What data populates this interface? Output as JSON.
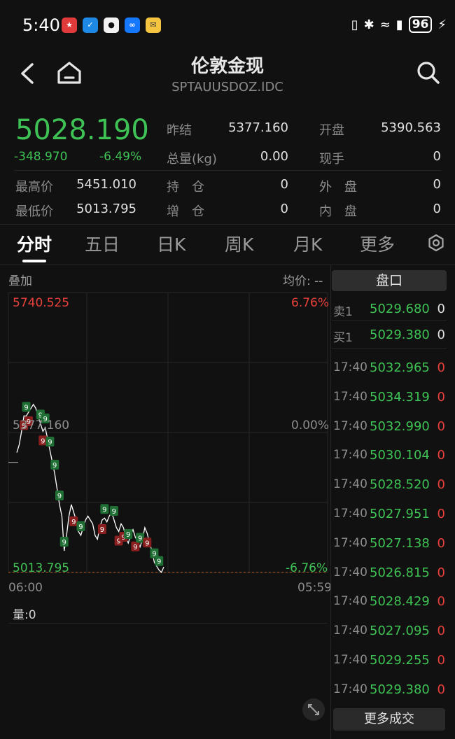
{
  "status_bar": {
    "time": "5:40",
    "battery": "96",
    "icons": [
      "nfc-icon",
      "bluetooth-icon",
      "wifi-icon",
      "signal-icon",
      "charging-icon"
    ]
  },
  "header": {
    "title": "伦敦金现",
    "subtitle": "SPTAUUSDOZ.IDC"
  },
  "quote": {
    "price": "5028.190",
    "change": "-348.970",
    "change_pct": "-6.49%",
    "fields": [
      {
        "label": "昨结",
        "value": "5377.160"
      },
      {
        "label": "开盘",
        "value": "5390.563"
      },
      {
        "label": "总量(kg)",
        "value": "0.00"
      },
      {
        "label": "现手",
        "value": "0"
      },
      {
        "label": "最高价",
        "value": "5451.010"
      },
      {
        "label": "持　仓",
        "value": "0"
      },
      {
        "label": "外　盘",
        "value": "0"
      },
      {
        "label": "最低价",
        "value": "5013.795"
      },
      {
        "label": "增　仓",
        "value": "0"
      },
      {
        "label": "内　盘",
        "value": "0"
      }
    ]
  },
  "tabs": [
    {
      "label": "分时"
    },
    {
      "label": "五日"
    },
    {
      "label": "日K"
    },
    {
      "label": "周K"
    },
    {
      "label": "月K"
    },
    {
      "label": "更多"
    }
  ],
  "chart": {
    "overlay_label": "叠加",
    "avg_label": "均价: --",
    "top_price": "5740.525",
    "top_pct": "6.76%",
    "mid_price": "5377.160",
    "mid_pct": "0.00%",
    "bottom_price": "5013.795",
    "bottom_pct": "-6.76%",
    "time_start": "06:00",
    "time_end": "05:59",
    "volume_label": "量:0",
    "marker_text": "9",
    "colors": {
      "up": "#e8413b",
      "down": "#3fc255",
      "line": "#ffffff",
      "grid": "#262626"
    }
  },
  "chart_data": {
    "type": "line",
    "title": "",
    "xlabel": "",
    "ylabel": "",
    "ylim": [
      5013.795,
      5740.525
    ],
    "x_labels": [
      "06:00",
      "05:59"
    ],
    "series": [
      {
        "values": [
          5325,
          5345,
          5380,
          5420,
          5420,
          5430,
          5440,
          5450,
          5440,
          5420,
          5400,
          5380,
          5390,
          5360,
          5330,
          5300,
          5270,
          5230,
          5190,
          5160,
          5070,
          5110,
          5160,
          5190,
          5170,
          5150,
          5120,
          5110,
          5130,
          5150,
          5160,
          5150,
          5140,
          5110,
          5100,
          5130,
          5150,
          5155,
          5145,
          5160,
          5170,
          5150,
          5130,
          5120,
          5140,
          5130,
          5105,
          5090,
          5110,
          5125,
          5105,
          5095,
          5080,
          5100,
          5130,
          5115,
          5090,
          5070,
          5040,
          5030,
          5020,
          5014,
          5028
        ]
      }
    ],
    "markers": [
      {
        "index": 3,
        "type": "down"
      },
      {
        "index": 5,
        "type": "down"
      },
      {
        "index": 4,
        "type": "up"
      },
      {
        "index": 10,
        "type": "up"
      },
      {
        "index": 11,
        "type": "down"
      },
      {
        "index": 12,
        "type": "up"
      },
      {
        "index": 14,
        "type": "up"
      },
      {
        "index": 16,
        "type": "up"
      },
      {
        "index": 18,
        "type": "up"
      },
      {
        "index": 20,
        "type": "up"
      },
      {
        "index": 24,
        "type": "down"
      },
      {
        "index": 27,
        "type": "up"
      },
      {
        "index": 36,
        "type": "down"
      },
      {
        "index": 37,
        "type": "up"
      },
      {
        "index": 41,
        "type": "up"
      },
      {
        "index": 43,
        "type": "down"
      },
      {
        "index": 45,
        "type": "down"
      },
      {
        "index": 47,
        "type": "up"
      },
      {
        "index": 50,
        "type": "down"
      },
      {
        "index": 52,
        "type": "up"
      },
      {
        "index": 55,
        "type": "down"
      },
      {
        "index": 58,
        "type": "up"
      },
      {
        "index": 60,
        "type": "up"
      }
    ]
  },
  "order_book": {
    "title": "盘口",
    "asks": [
      {
        "label": "卖1",
        "price": "5029.680",
        "volume": "0"
      }
    ],
    "bids": [
      {
        "label": "买1",
        "price": "5029.380",
        "volume": "0"
      }
    ]
  },
  "trades": [
    {
      "time": "17:40",
      "price": "5032.965",
      "volume": "0"
    },
    {
      "time": "17:40",
      "price": "5034.319",
      "volume": "0"
    },
    {
      "time": "17:40",
      "price": "5032.990",
      "volume": "0"
    },
    {
      "time": "17:40",
      "price": "5030.104",
      "volume": "0"
    },
    {
      "time": "17:40",
      "price": "5028.520",
      "volume": "0"
    },
    {
      "time": "17:40",
      "price": "5027.951",
      "volume": "0"
    },
    {
      "time": "17:40",
      "price": "5027.138",
      "volume": "0"
    },
    {
      "time": "17:40",
      "price": "5026.815",
      "volume": "0"
    },
    {
      "time": "17:40",
      "price": "5028.429",
      "volume": "0"
    },
    {
      "time": "17:40",
      "price": "5027.095",
      "volume": "0"
    },
    {
      "time": "17:40",
      "price": "5029.255",
      "volume": "0"
    },
    {
      "time": "17:40",
      "price": "5029.380",
      "volume": "0"
    }
  ],
  "more_trades_label": "更多成交"
}
